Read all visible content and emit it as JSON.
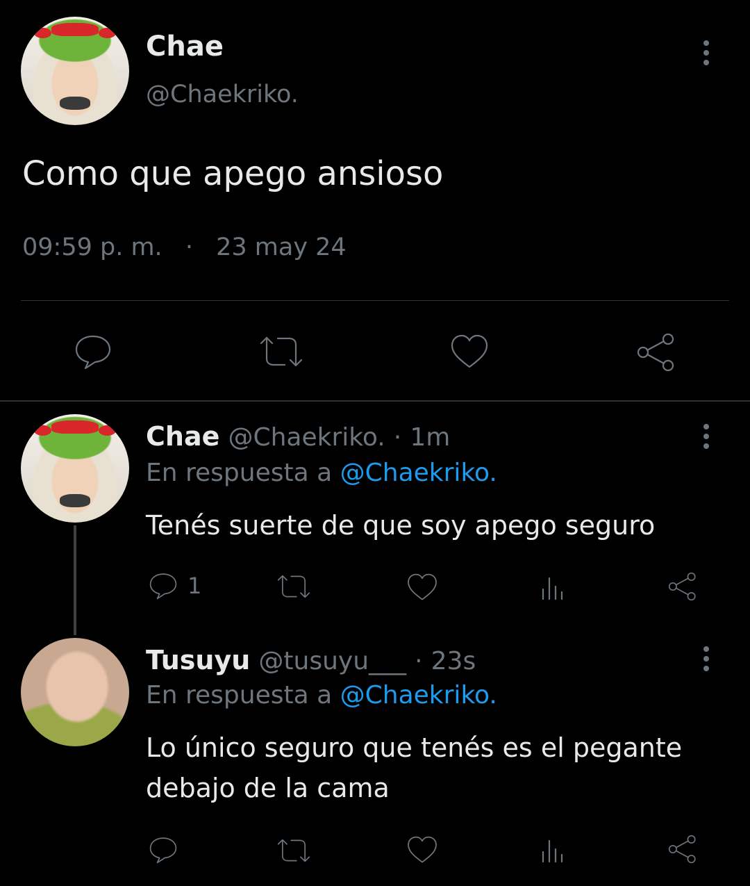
{
  "main_tweet": {
    "display_name": "Chae",
    "handle": "@Chaekriko.",
    "text": "Como que apego ansioso",
    "time": "09:59 p. m.",
    "separator": "·",
    "date": "23 may 24"
  },
  "replies": [
    {
      "display_name": "Chae",
      "handle": "@Chaekriko.",
      "dot": "·",
      "age": "1m",
      "reply_prefix": "En respuesta a",
      "reply_to": "@Chaekriko.",
      "text": "Tenés suerte de que soy apego seguro",
      "reply_count": "1"
    },
    {
      "display_name": "Tusuyu",
      "handle": "@tusuyu___",
      "dot": "·",
      "age": "23s",
      "reply_prefix": "En respuesta a",
      "reply_to": "@Chaekriko.",
      "text_line1": "Lo único seguro que tenés es el pegante",
      "text_line2": "debajo de la cama",
      "reply_count": ""
    }
  ],
  "colors": {
    "background": "#000000",
    "text": "#e7e9ea",
    "muted": "#6e767d",
    "link": "#1d9bf0"
  },
  "icons": [
    "more-icon",
    "reply-icon",
    "retweet-icon",
    "like-icon",
    "share-icon",
    "views-icon"
  ]
}
